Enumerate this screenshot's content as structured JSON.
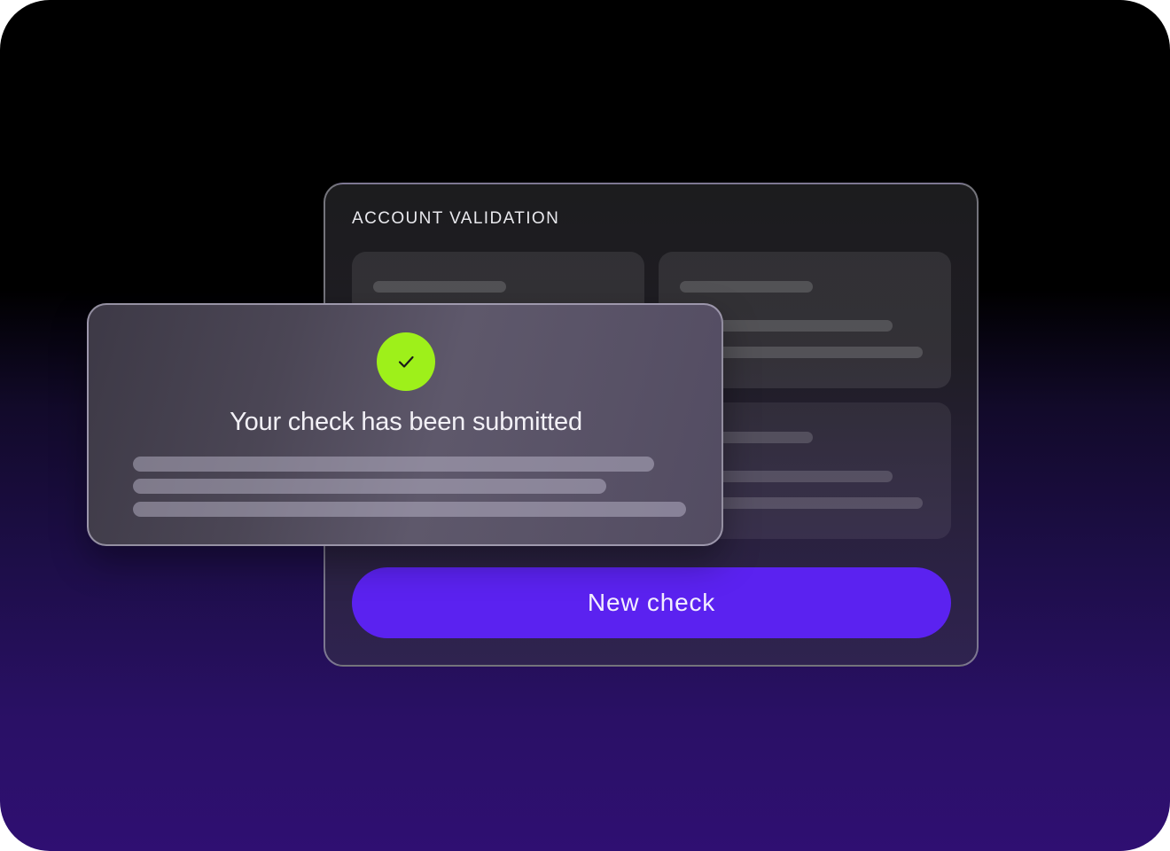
{
  "validation_panel": {
    "title": "ACCOUNT VALIDATION",
    "new_check_label": "New check"
  },
  "toast": {
    "message": "Your check has been submitted",
    "icon": "checkmark-icon"
  },
  "colors": {
    "accent_button": "#5b22f0",
    "success_badge": "#9ef01a",
    "background_bottom": "#2f0f72"
  }
}
